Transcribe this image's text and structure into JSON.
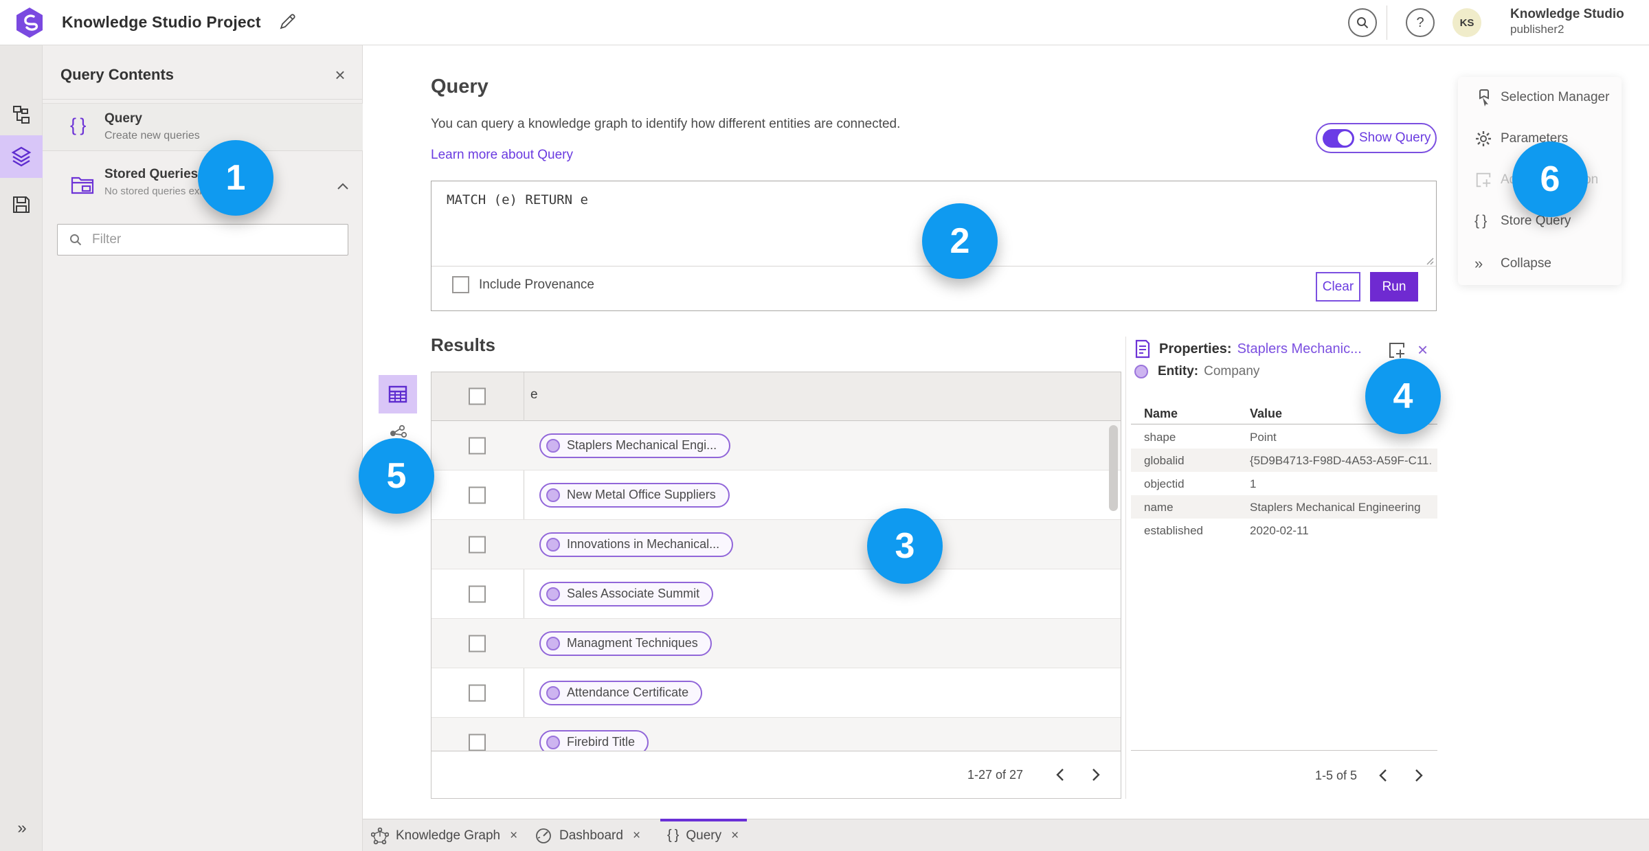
{
  "colors": {
    "accent_purple": "#6d33d6",
    "toggle_purple": "#6b3ce6",
    "link_purple": "#6a3be0",
    "annotation_blue": "#0f9af0",
    "pill_border": "#9166d9",
    "avatar_bg": "#f0ecca"
  },
  "header": {
    "title": "Knowledge Studio Project",
    "account_initials": "KS",
    "account_name": "Knowledge Studio",
    "account_user": "publisher2"
  },
  "contents_panel": {
    "title": "Query Contents",
    "query_item": {
      "label": "Query",
      "description": "Create new queries"
    },
    "stored_item": {
      "label": "Stored Queries",
      "description": "No stored queries exist"
    },
    "filter_placeholder": "Filter"
  },
  "query_panel": {
    "heading": "Query",
    "description": "You can query a knowledge graph to identify how different entities are connected.",
    "learn_more_link": "Learn more about Query",
    "show_query_label": "Show Query",
    "query_text": "MATCH (e) RETURN e",
    "include_provenance_label": "Include Provenance",
    "clear_button": "Clear",
    "run_button": "Run"
  },
  "results": {
    "heading": "Results",
    "column_header": "e",
    "rows": [
      "Staplers Mechanical Engi...",
      "New Metal Office Suppliers",
      "Innovations in Mechanical...",
      "Sales Associate Summit",
      "Managment Techniques",
      "Attendance Certificate",
      "Firebird Title"
    ],
    "pagination": "1-27 of 27"
  },
  "properties": {
    "label": "Properties:",
    "entity_name": "Staplers Mechanic...",
    "entity_label": "Entity:",
    "entity_type": "Company",
    "name_header": "Name",
    "value_header": "Value",
    "rows": [
      {
        "name": "shape",
        "value": "Point"
      },
      {
        "name": "globalid",
        "value": "{5D9B4713-F98D-4A53-A59F-C11..."
      },
      {
        "name": "objectid",
        "value": "1"
      },
      {
        "name": "name",
        "value": "Staplers Mechanical Engineering"
      },
      {
        "name": "established",
        "value": "2020-02-11"
      }
    ],
    "pagination": "1-5 of 5"
  },
  "side_menu": {
    "items": [
      "Selection Manager",
      "Parameters",
      "Add To Selection",
      "Store Query",
      "Collapse"
    ]
  },
  "bottom_tabs": {
    "tabs": [
      {
        "label": "Knowledge Graph"
      },
      {
        "label": "Dashboard"
      },
      {
        "label": "Query"
      }
    ]
  },
  "annotations": [
    "1",
    "2",
    "3",
    "4",
    "5",
    "6"
  ]
}
